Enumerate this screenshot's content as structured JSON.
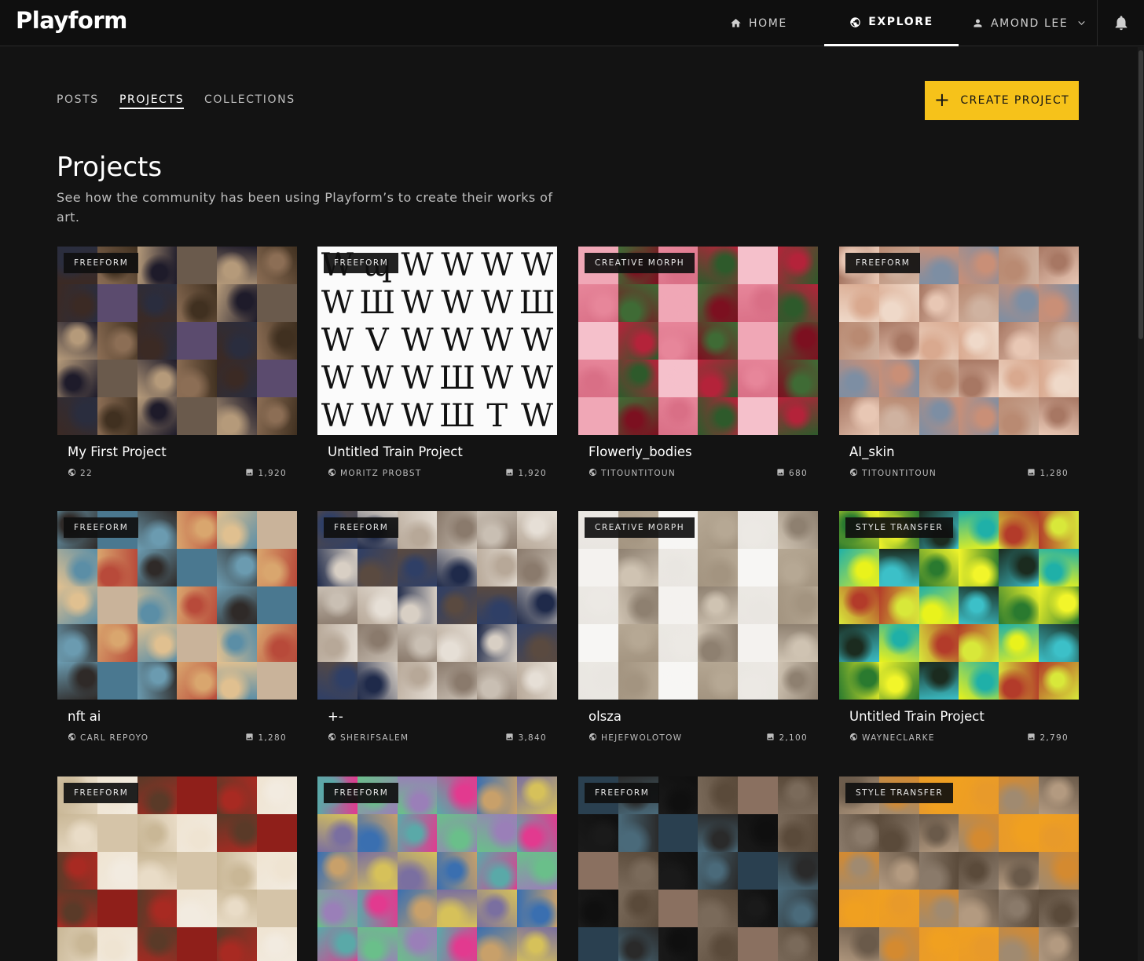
{
  "brand": {
    "logo_text": "Playform"
  },
  "nav": {
    "home": "HOME",
    "explore": "EXPLORE",
    "user": "AMOND LEE"
  },
  "tabs": {
    "posts": "POSTS",
    "projects": "PROJECTS",
    "collections": "COLLECTIONS"
  },
  "actions": {
    "create_project": "CREATE PROJECT"
  },
  "page": {
    "title": "Projects",
    "subtitle": "See how the community has been using Playform’s to create their works of art."
  },
  "icons": {
    "home": "home-icon",
    "explore": "globe-icon",
    "user": "person-icon",
    "user_menu": "chevron-down-icon",
    "notifications": "bell-icon",
    "create": "plus-icon",
    "author": "globe-icon",
    "count": "image-icon"
  },
  "colors": {
    "accent": "#f6c21a",
    "background": "#131313",
    "topbar": "#0f0f0f"
  },
  "projects": [
    {
      "tag": "FREEFORM",
      "title": "My First Project",
      "author": "22",
      "count": "1,920",
      "palette": [
        "#3b2a24",
        "#6a5a4c",
        "#2a2d3e",
        "#8c6e55",
        "#1e1b2a",
        "#5b4b6e",
        "#b59a7a",
        "#403020"
      ]
    },
    {
      "tag": "FREEFORM",
      "title": "Untitled Train Project",
      "author": "MORITZ PROBST",
      "count": "1,920",
      "palette": []
    },
    {
      "tag": "CREATIVE MORPH",
      "title": "Flowerly_bodies",
      "author": "TITOUNTITOUN",
      "count": "680",
      "palette": [
        "#e7869a",
        "#2e5a2b",
        "#f0a7b6",
        "#b4233a",
        "#d96f86",
        "#3f6b35",
        "#f5c0cb",
        "#7c1020"
      ]
    },
    {
      "tag": "FREEFORM",
      "title": "AI_skin",
      "author": "TITOUNTITOUN",
      "count": "1,280",
      "palette": [
        "#d9a98f",
        "#c98f77",
        "#e8c7b4",
        "#a77763",
        "#7d8ea3",
        "#efd9c9",
        "#b98a72",
        "#cfb2a0"
      ]
    },
    {
      "tag": "FREEFORM",
      "title": "nft ai",
      "author": "CARL REPOYO",
      "count": "1,280",
      "palette": [
        "#5b8ea6",
        "#d9a66e",
        "#2f2a28",
        "#c9b39a",
        "#6b9bb0",
        "#b84a3a",
        "#e0c090",
        "#4a7890"
      ]
    },
    {
      "tag": "FREEFORM",
      "title": "+-",
      "author": "SHERIFSALEM",
      "count": "3,840",
      "palette": [
        "#d8cfc4",
        "#8a7a6c",
        "#2f3f66",
        "#e6dfd6",
        "#b7a898",
        "#5a4a40",
        "#c9bfb3",
        "#1f2a4a"
      ]
    },
    {
      "tag": "CREATIVE MORPH",
      "title": "olsza",
      "author": "HEJEFWOLOTOW",
      "count": "2,100",
      "palette": [
        "#f4f2ef",
        "#b6a894",
        "#e9e6e1",
        "#8e8070",
        "#f7f6f4",
        "#cfc3b2",
        "#ece9e4",
        "#a39480"
      ]
    },
    {
      "tag": "STYLE TRANSFER",
      "title": "Untitled Train Project",
      "author": "WAYNECLARKE",
      "count": "2,790",
      "palette": [
        "#e9f21c",
        "#1fb0a8",
        "#2a7a2f",
        "#d8e83a",
        "#1b2b1f",
        "#3cc0c8",
        "#b33b2a",
        "#f2f52a"
      ]
    },
    {
      "tag": "FREEFORM",
      "title": "",
      "author": "",
      "count": "",
      "palette": [
        "#e9dcc7",
        "#8f1f1a",
        "#c9b796",
        "#f2ebe0",
        "#5a3a28",
        "#d5c4a8",
        "#a82a22",
        "#efe4d2"
      ]
    },
    {
      "tag": "FREEFORM",
      "title": "",
      "author": "",
      "count": "",
      "palette": [
        "#7a6fa0",
        "#e23a8f",
        "#5aa9a8",
        "#d6c15a",
        "#9a7fb8",
        "#3a6fb0",
        "#c8a06a",
        "#6abf8a"
      ]
    },
    {
      "tag": "FREEFORM",
      "title": "",
      "author": "",
      "count": "",
      "palette": [
        "#1a1a1a",
        "#5a4a3a",
        "#2a4050",
        "#7a6a5a",
        "#0f0f0f",
        "#4a6a7a",
        "#8a7060",
        "#2a2a2a"
      ]
    },
    {
      "tag": "STYLE TRANSFER",
      "title": "",
      "author": "",
      "count": "",
      "palette": [
        "#8a7a6a",
        "#e89a2a",
        "#6a5a4a",
        "#b39a80",
        "#f0a020",
        "#5a4a3a",
        "#a08a70",
        "#d48a30"
      ]
    }
  ],
  "w_glyphs": [
    "W",
    "ɰ",
    "W",
    "W",
    "W",
    "W",
    "W",
    "Ш",
    "W",
    "W",
    "W",
    "Ш",
    "W",
    "V",
    "W",
    "W",
    "W",
    "W",
    "W",
    "W",
    "W",
    "Ш",
    "W",
    "W",
    "W",
    "W",
    "W",
    "Ш",
    "T",
    "W"
  ]
}
